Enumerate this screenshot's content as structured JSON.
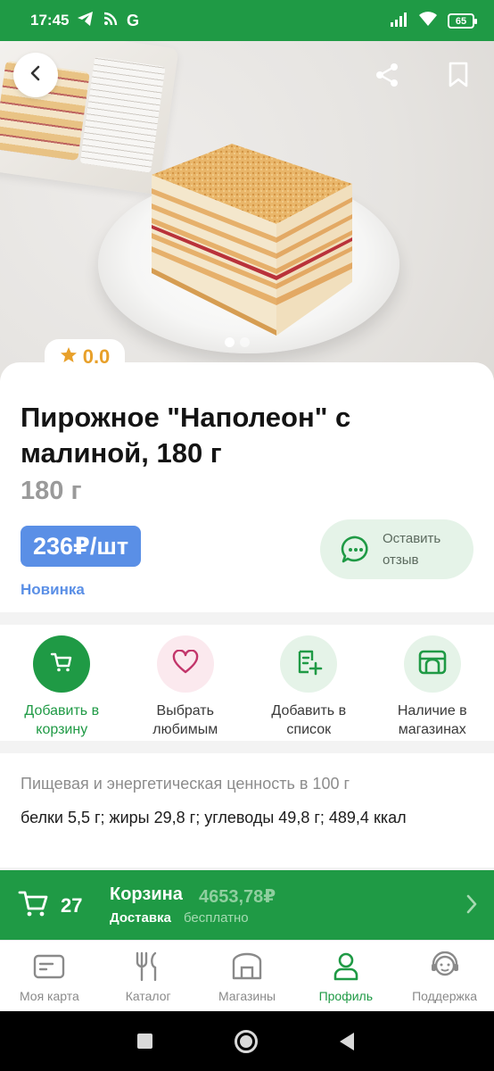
{
  "status_bar": {
    "time": "17:45",
    "battery": "65",
    "left_icons": [
      "telegram-icon",
      "rss-icon",
      "google-icon"
    ],
    "right_icons": [
      "signal-icon",
      "wifi-icon",
      "battery-icon"
    ]
  },
  "hero": {
    "image_alt": "Пирожное Наполеон с малиной на тарелке",
    "slides_count": 2,
    "active_slide": 1,
    "icons": {
      "back": "chevron-left-icon",
      "share": "share-icon",
      "bookmark": "bookmark-icon"
    }
  },
  "product": {
    "rating": "0.0",
    "title": "Пирожное \"Наполеон\" с малиной, 180 г",
    "weight": "180 г",
    "price": "236₽/шт",
    "badge": "Новинка",
    "review_button": "Оставить отзыв"
  },
  "actions": [
    {
      "label": "Добавить в корзину",
      "icon": "cart-icon"
    },
    {
      "label": "Выбрать любимым",
      "icon": "heart-icon"
    },
    {
      "label": "Добавить в список",
      "icon": "list-add-icon"
    },
    {
      "label": "Наличие в магазинах",
      "icon": "store-icon"
    }
  ],
  "nutrition": {
    "title": "Пищевая и энергетическая ценность в 100 г",
    "text": "белки 5,5 г; жиры 29,8 г; углеводы 49,8 г; 489,4 ккал"
  },
  "cart": {
    "count": "27",
    "title": "Корзина",
    "sum": "4653,78₽",
    "delivery_label": "Доставка",
    "delivery_value": "бесплатно"
  },
  "bottom_nav": [
    {
      "label": "Моя карта",
      "icon": "card-icon",
      "active": false
    },
    {
      "label": "Каталог",
      "icon": "fork-knife-icon",
      "active": false
    },
    {
      "label": "Магазины",
      "icon": "store-icon",
      "active": false
    },
    {
      "label": "Профиль",
      "icon": "person-icon",
      "active": true
    },
    {
      "label": "Поддержка",
      "icon": "support-icon",
      "active": false
    }
  ],
  "colors": {
    "brand_green": "#1f9a45",
    "price_blue": "#5a8fe6",
    "rating_orange": "#e8a02a",
    "light_green": "#e5f3e8",
    "light_pink": "#fbe9ee"
  }
}
